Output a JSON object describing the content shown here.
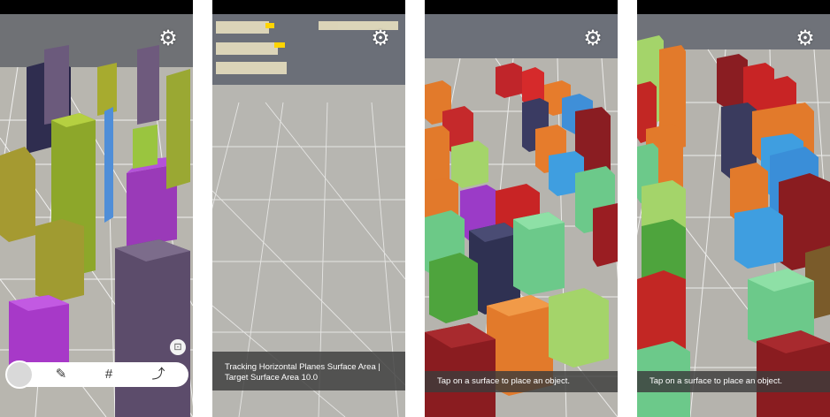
{
  "screens": [
    {
      "settings_icon": "gear-icon",
      "toolbar": {
        "edit_icon": "edit-icon",
        "grid_icon": "#",
        "share_icon": "share-icon",
        "capture_icon": "text-scan-icon"
      }
    },
    {
      "settings_icon": "gear-icon",
      "message": "Tracking Horizontal Planes Surface Area | Target Surface Area 10.0"
    },
    {
      "settings_icon": "gear-icon",
      "message": "Tap on a surface to place an object."
    },
    {
      "settings_icon": "gear-icon",
      "message": "Tap on a surface to place an object."
    }
  ],
  "colors": {
    "floor": "#b9b7b0",
    "grid": "#ffffff",
    "statusbar": "#000000",
    "cube_palette": [
      "#a4c233",
      "#9b3bc7",
      "#6a5b7a",
      "#e2792b",
      "#3f9ee0",
      "#6cc987",
      "#c22724",
      "#7a1d20",
      "#3b3c5e",
      "#4ea43d"
    ]
  }
}
